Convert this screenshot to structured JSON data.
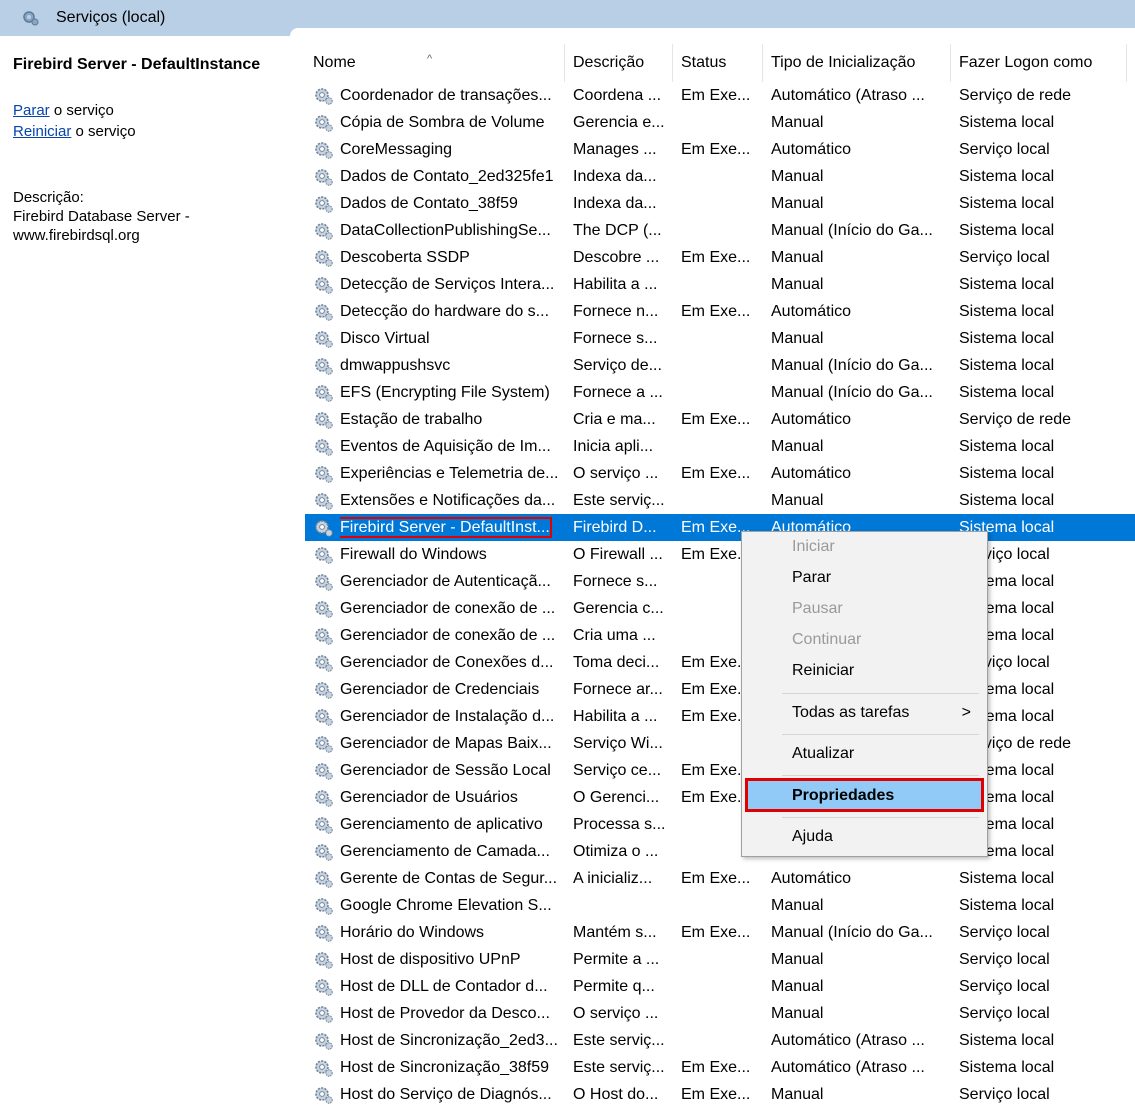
{
  "window": {
    "title": "Serviços (local)"
  },
  "left_panel": {
    "service_title": "Firebird Server - DefaultInstance",
    "stop_link": "Parar",
    "stop_suffix": " o serviço",
    "restart_link": "Reiniciar",
    "restart_suffix": " o serviço",
    "desc_label": "Descrição:",
    "desc_line1": "Firebird Database Server -",
    "desc_line2": "www.firebirdsql.org"
  },
  "table": {
    "headers": [
      "Nome",
      "Descrição",
      "Status",
      "Tipo de Inicialização",
      "Fazer Logon como"
    ],
    "rows": [
      [
        "Coordenador de transações...",
        "Coordena ...",
        "Em Exe...",
        "Automático (Atraso ...",
        "Serviço de rede"
      ],
      [
        "Cópia de Sombra de Volume",
        "Gerencia e...",
        "",
        "Manual",
        "Sistema local"
      ],
      [
        "CoreMessaging",
        "Manages ...",
        "Em Exe...",
        "Automático",
        "Serviço local"
      ],
      [
        "Dados de Contato_2ed325fe1",
        "Indexa da...",
        "",
        "Manual",
        "Sistema local"
      ],
      [
        "Dados de Contato_38f59",
        "Indexa da...",
        "",
        "Manual",
        "Sistema local"
      ],
      [
        "DataCollectionPublishingSe...",
        "The DCP (...",
        "",
        "Manual (Início do Ga...",
        "Sistema local"
      ],
      [
        "Descoberta SSDP",
        "Descobre ...",
        "Em Exe...",
        "Manual",
        "Serviço local"
      ],
      [
        "Detecção de Serviços Intera...",
        "Habilita a ...",
        "",
        "Manual",
        "Sistema local"
      ],
      [
        "Detecção do hardware do s...",
        "Fornece n...",
        "Em Exe...",
        "Automático",
        "Sistema local"
      ],
      [
        "Disco Virtual",
        "Fornece s...",
        "",
        "Manual",
        "Sistema local"
      ],
      [
        "dmwappushsvc",
        "Serviço de...",
        "",
        "Manual (Início do Ga...",
        "Sistema local"
      ],
      [
        "EFS (Encrypting File System)",
        "Fornece a ...",
        "",
        "Manual (Início do Ga...",
        "Sistema local"
      ],
      [
        "Estação de trabalho",
        "Cria e ma...",
        "Em Exe...",
        "Automático",
        "Serviço de rede"
      ],
      [
        "Eventos de Aquisição de Im...",
        "Inicia apli...",
        "",
        "Manual",
        "Sistema local"
      ],
      [
        "Experiências e Telemetria de...",
        "O serviço ...",
        "Em Exe...",
        "Automático",
        "Sistema local"
      ],
      [
        "Extensões e Notificações da...",
        "Este serviç...",
        "",
        "Manual",
        "Sistema local"
      ],
      [
        "Firebird Server - DefaultInst...",
        "Firebird D...",
        "Em Exe...",
        "Automático",
        "Sistema local"
      ],
      [
        "Firewall do Windows",
        "O Firewall ...",
        "Em Exe...",
        "",
        "Serviço local"
      ],
      [
        "Gerenciador de Autenticaçã...",
        "Fornece s...",
        "",
        "",
        "Sistema local"
      ],
      [
        "Gerenciador de conexão de ...",
        "Gerencia c...",
        "",
        "",
        "Sistema local"
      ],
      [
        "Gerenciador de conexão de ...",
        "Cria uma ...",
        "",
        "",
        "Sistema local"
      ],
      [
        "Gerenciador de Conexões d...",
        "Toma deci...",
        "Em Exe...",
        "",
        "Serviço local"
      ],
      [
        "Gerenciador de Credenciais",
        "Fornece ar...",
        "Em Exe...",
        "",
        "Sistema local"
      ],
      [
        "Gerenciador de Instalação d...",
        "Habilita a ...",
        "Em Exe...",
        "",
        "Sistema local"
      ],
      [
        "Gerenciador de Mapas Baix...",
        "Serviço Wi...",
        "",
        "",
        "Serviço de rede"
      ],
      [
        "Gerenciador de Sessão Local",
        "Serviço ce...",
        "Em Exe...",
        "",
        "Sistema local"
      ],
      [
        "Gerenciador de Usuários",
        "O Gerenci...",
        "Em Exe...",
        "",
        "Sistema local"
      ],
      [
        "Gerenciamento de aplicativo",
        "Processa s...",
        "",
        "",
        "Sistema local"
      ],
      [
        "Gerenciamento de Camada...",
        "Otimiza o ...",
        "",
        "",
        "Sistema local"
      ],
      [
        "Gerente de Contas de Segur...",
        "A inicializ...",
        "Em Exe...",
        "Automático",
        "Sistema local"
      ],
      [
        "Google Chrome Elevation S...",
        "",
        "",
        "Manual",
        "Sistema local"
      ],
      [
        "Horário do Windows",
        "Mantém s...",
        "Em Exe...",
        "Manual (Início do Ga...",
        "Serviço local"
      ],
      [
        "Host de dispositivo UPnP",
        "Permite a ...",
        "",
        "Manual",
        "Serviço local"
      ],
      [
        "Host de DLL de Contador d...",
        "Permite q...",
        "",
        "Manual",
        "Serviço local"
      ],
      [
        "Host de Provedor da Desco...",
        "O serviço ...",
        "",
        "Manual",
        "Serviço local"
      ],
      [
        "Host de Sincronização_2ed3...",
        "Este serviç...",
        "",
        "Automático (Atraso ...",
        "Sistema local"
      ],
      [
        "Host de Sincronização_38f59",
        "Este serviç...",
        "Em Exe...",
        "Automático (Atraso ...",
        "Sistema local"
      ],
      [
        "Host do Serviço de Diagnós...",
        "O Host do...",
        "Em Exe...",
        "Manual",
        "Serviço local"
      ]
    ],
    "selected_index": 16
  },
  "context_menu": {
    "items": [
      {
        "label": "Iniciar",
        "disabled": true
      },
      {
        "label": "Parar",
        "disabled": false
      },
      {
        "label": "Pausar",
        "disabled": true
      },
      {
        "label": "Continuar",
        "disabled": true
      },
      {
        "label": "Reiniciar",
        "disabled": false
      },
      {
        "label": "Todas as tarefas",
        "disabled": false,
        "submenu_arrow": ">"
      },
      {
        "label": "Atualizar",
        "disabled": false
      },
      {
        "label": "Propriedades",
        "disabled": false,
        "highlighted": true
      },
      {
        "label": "Ajuda",
        "disabled": false
      }
    ]
  },
  "colors": {
    "selection": "#0078d7",
    "highlight_outline": "#e00000",
    "menu_hover": "#91c9f7",
    "titlebar": "#b9cfe6"
  },
  "icons": {
    "service": "gear-icon",
    "title": "services-gear-icon"
  }
}
